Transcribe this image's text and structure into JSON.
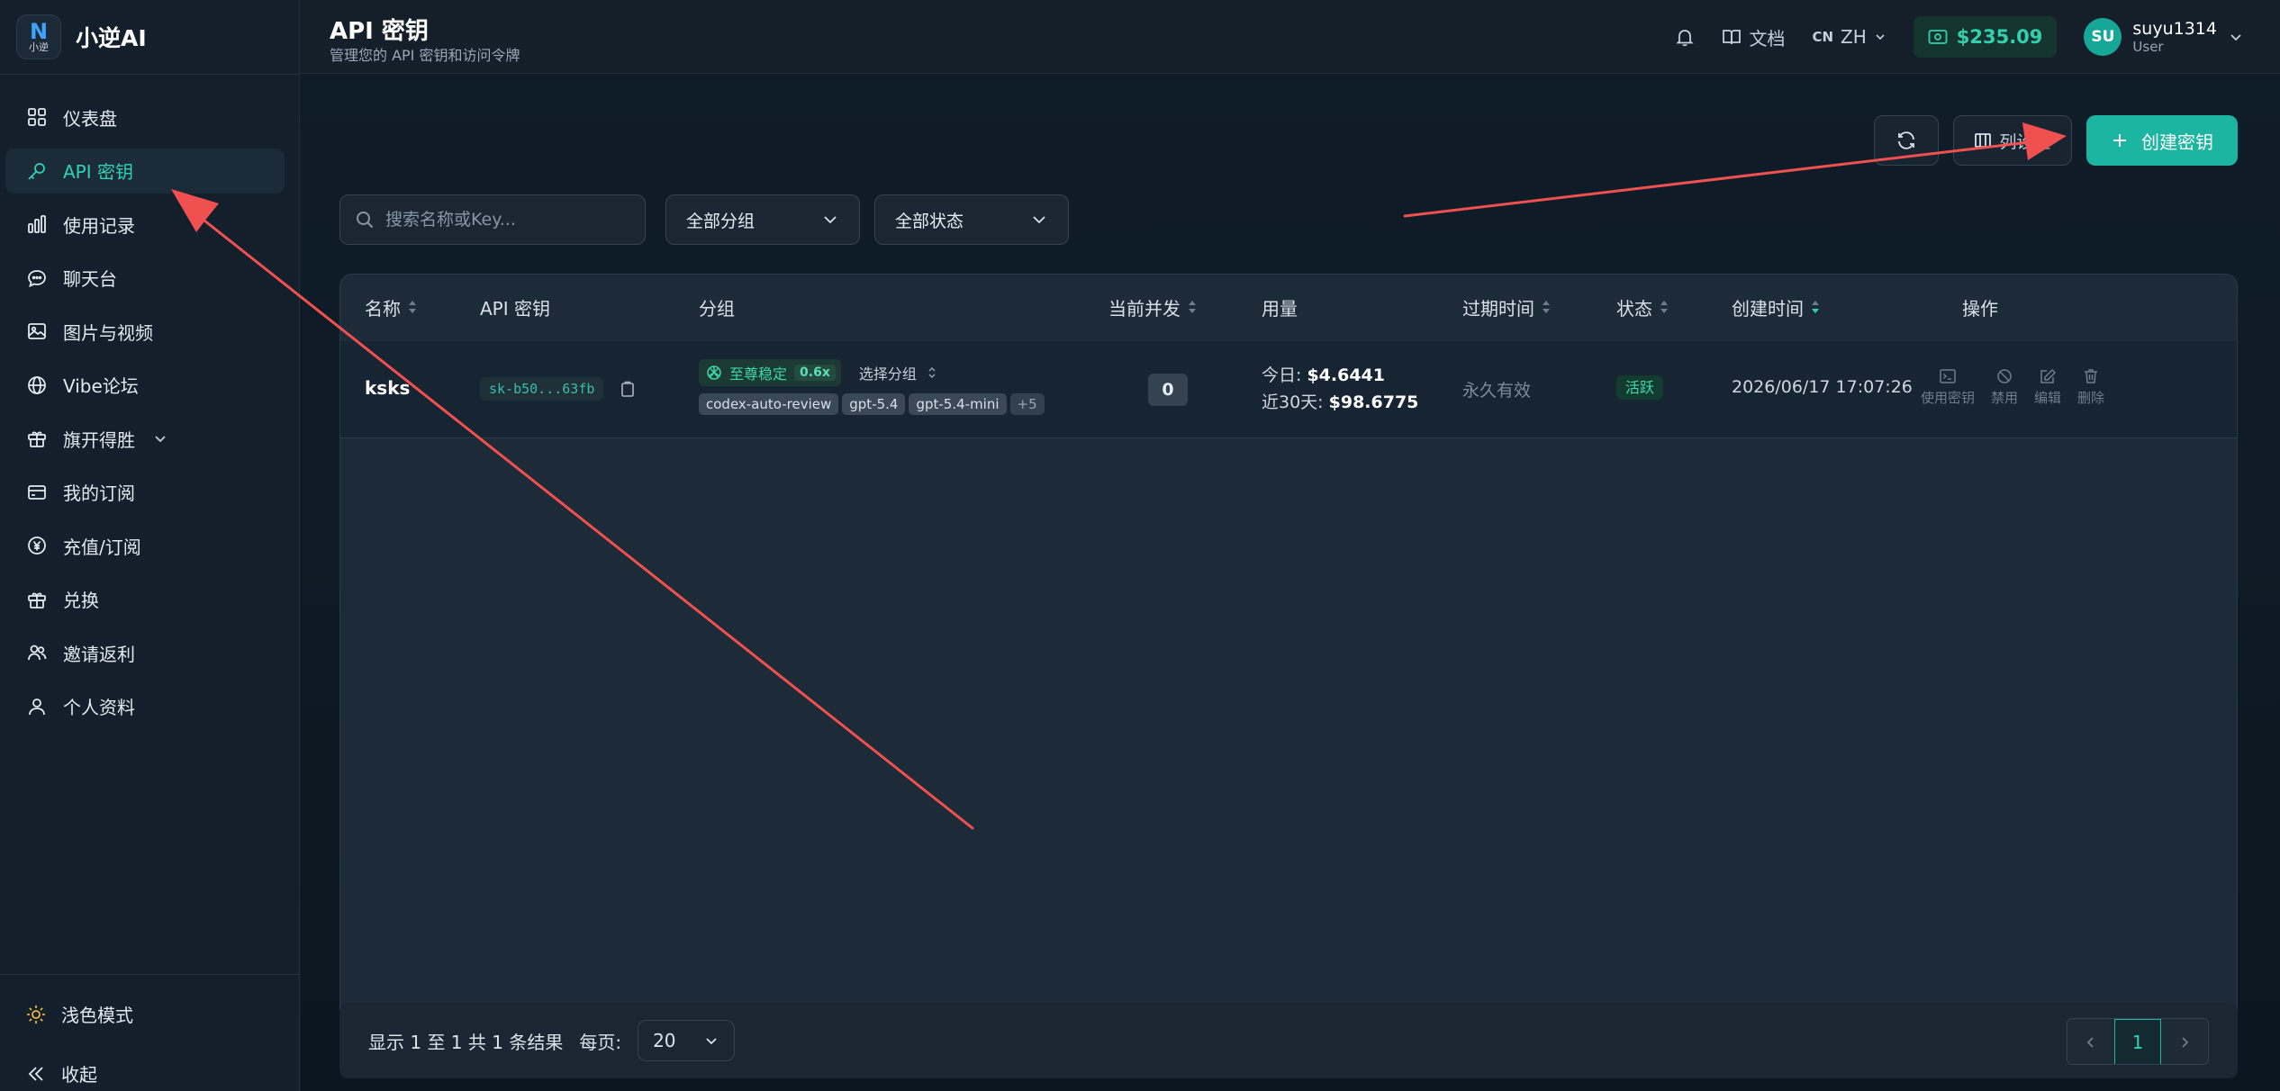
{
  "brand": {
    "logo_letter": "N",
    "logo_sub": "小逆",
    "name": "小逆AI"
  },
  "sidebar": {
    "items": [
      {
        "label": "仪表盘",
        "icon": "dashboard-icon",
        "active": false
      },
      {
        "label": "API 密钥",
        "icon": "key-icon",
        "active": true
      },
      {
        "label": "使用记录",
        "icon": "bar-chart-icon",
        "active": false
      },
      {
        "label": "聊天台",
        "icon": "chat-icon",
        "active": false
      },
      {
        "label": "图片与视频",
        "icon": "image-icon",
        "active": false
      },
      {
        "label": "Vibe论坛",
        "icon": "globe-icon",
        "active": false
      },
      {
        "label": "旗开得胜",
        "icon": "gift-icon",
        "active": false,
        "expandable": true
      },
      {
        "label": "我的订阅",
        "icon": "card-icon",
        "active": false
      },
      {
        "label": "充值/订阅",
        "icon": "yen-coin-icon",
        "active": false
      },
      {
        "label": "兑换",
        "icon": "gift-box-icon",
        "active": false
      },
      {
        "label": "邀请返利",
        "icon": "users-icon",
        "active": false
      },
      {
        "label": "个人资料",
        "icon": "user-icon",
        "active": false
      }
    ],
    "theme_label": "浅色模式",
    "collapse_label": "收起"
  },
  "header": {
    "title": "API 密钥",
    "subtitle": "管理您的 API 密钥和访问令牌",
    "docs_label": "文档",
    "lang_flag": "CN",
    "lang_label": "ZH",
    "balance": "$235.09",
    "user_initials": "SU",
    "user_name": "suyu1314",
    "user_role": "User"
  },
  "toolbar": {
    "columns_label": "列设置",
    "create_label": "创建密钥",
    "search_placeholder": "搜索名称或Key...",
    "group_filter": "全部分组",
    "status_filter": "全部状态"
  },
  "table": {
    "columns": [
      "名称",
      "API 密钥",
      "分组",
      "当前并发",
      "用量",
      "过期时间",
      "状态",
      "创建时间",
      "操作"
    ],
    "rows": [
      {
        "name": "ksks",
        "key": "sk-b50...63fb",
        "group_name": "至尊稳定",
        "group_ratio": "0.6x",
        "group_select": "选择分组",
        "tags": [
          "codex-auto-review",
          "gpt-5.4",
          "gpt-5.4-mini",
          "+5"
        ],
        "concurrency": "0",
        "usage_today_label": "今日:",
        "usage_today": "$4.6441",
        "usage_30d_label": "近30天:",
        "usage_30d": "$98.6775",
        "expiry": "永久有效",
        "status": "活跃",
        "created": "2026/06/17 17:07:26",
        "actions": [
          "使用密钥",
          "禁用",
          "编辑",
          "删除"
        ]
      }
    ]
  },
  "pagination": {
    "summary": "显示 1 至 1 共 1 条结果",
    "per_page_label": "每页:",
    "per_page": "20",
    "current_page": "1"
  },
  "colors": {
    "accent": "#1bb5a2",
    "active_text": "#2fd2b9",
    "annotation_arrow": "#f0504f"
  }
}
